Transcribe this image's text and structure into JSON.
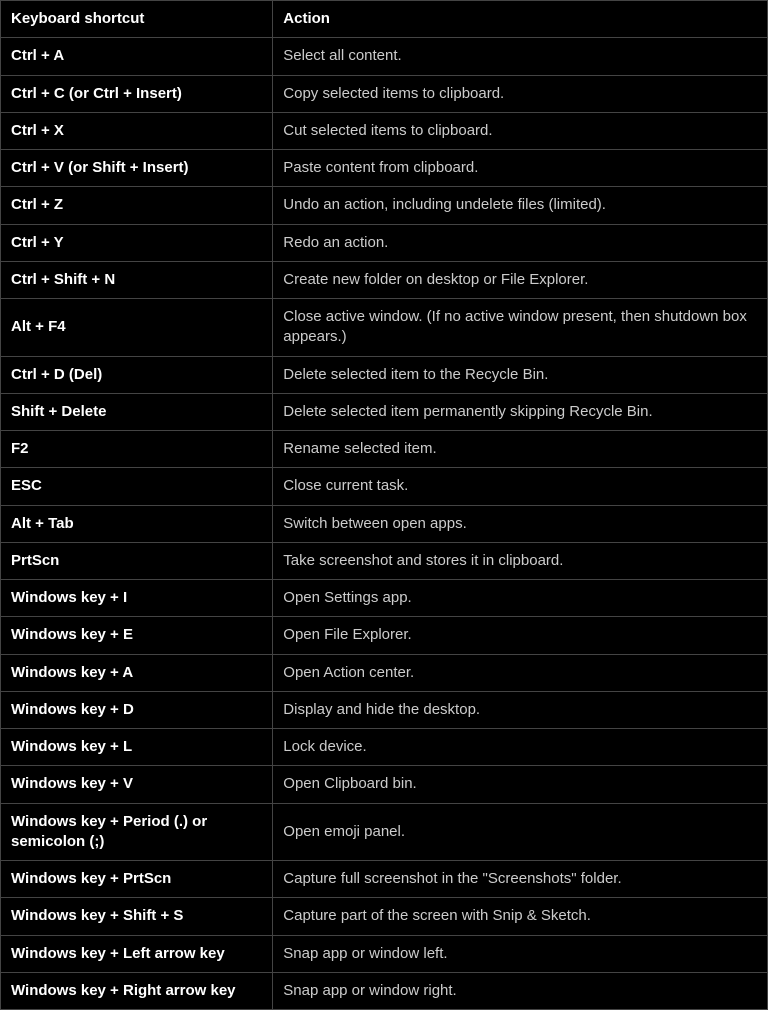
{
  "table": {
    "headers": {
      "shortcut": "Keyboard shortcut",
      "action": "Action"
    },
    "rows": [
      {
        "shortcut": "Ctrl + A",
        "action": "Select all content."
      },
      {
        "shortcut": "Ctrl + C (or Ctrl + Insert)",
        "action": "Copy selected items to clipboard."
      },
      {
        "shortcut": "Ctrl + X",
        "action": "Cut selected items to clipboard."
      },
      {
        "shortcut": "Ctrl + V (or Shift + Insert)",
        "action": "Paste content from clipboard."
      },
      {
        "shortcut": "Ctrl + Z",
        "action": "Undo an action, including undelete files (limited)."
      },
      {
        "shortcut": "Ctrl + Y",
        "action": "Redo an action."
      },
      {
        "shortcut": "Ctrl + Shift + N",
        "action": "Create new folder on desktop or File Explorer."
      },
      {
        "shortcut": "Alt + F4",
        "action": "Close active window. (If no active window present, then shutdown box appears.)"
      },
      {
        "shortcut": "Ctrl + D (Del)",
        "action": "Delete selected item to the Recycle Bin."
      },
      {
        "shortcut": "Shift + Delete",
        "action": "Delete selected item permanently skipping Recycle Bin."
      },
      {
        "shortcut": "F2",
        "action": "Rename selected item."
      },
      {
        "shortcut": "ESC",
        "action": "Close current task."
      },
      {
        "shortcut": "Alt + Tab",
        "action": "Switch between open apps."
      },
      {
        "shortcut": "PrtScn",
        "action": "Take screenshot and stores it in clipboard."
      },
      {
        "shortcut": "Windows key + I",
        "action": "Open Settings app."
      },
      {
        "shortcut": "Windows key + E",
        "action": "Open File Explorer."
      },
      {
        "shortcut": "Windows key + A",
        "action": "Open Action center."
      },
      {
        "shortcut": "Windows key + D",
        "action": "Display and hide the desktop."
      },
      {
        "shortcut": "Windows key + L",
        "action": "Lock device."
      },
      {
        "shortcut": "Windows key + V",
        "action": "Open Clipboard bin."
      },
      {
        "shortcut": "Windows key + Period (.) or semicolon (;)",
        "action": "Open emoji panel."
      },
      {
        "shortcut": "Windows key + PrtScn",
        "action": "Capture full screenshot in the \"Screenshots\" folder."
      },
      {
        "shortcut": "Windows key + Shift + S",
        "action": "Capture part of the screen with Snip & Sketch."
      },
      {
        "shortcut": "Windows key + Left arrow key",
        "action": "Snap app or window left."
      },
      {
        "shortcut": "Windows key + Right arrow key",
        "action": "Snap app or window right."
      }
    ]
  }
}
